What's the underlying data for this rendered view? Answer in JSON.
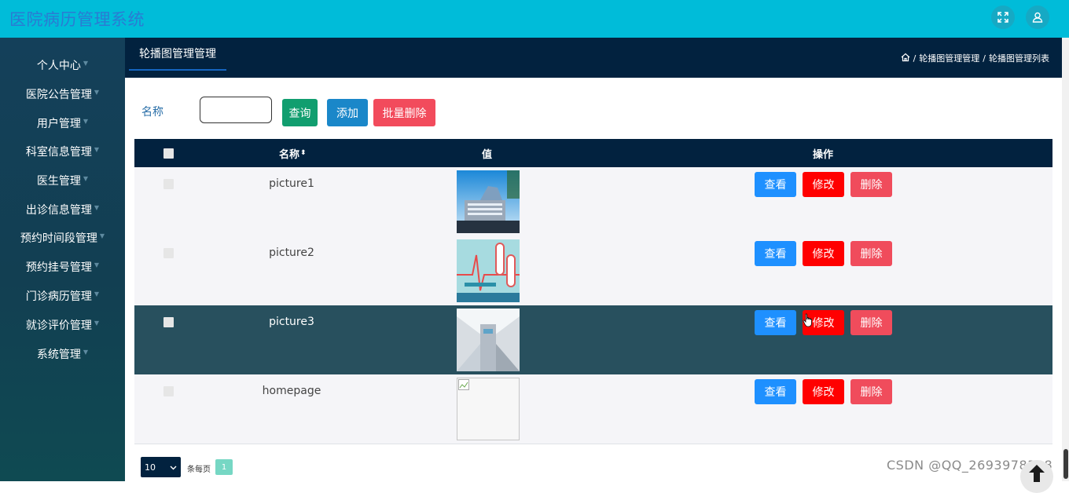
{
  "header": {
    "title": "医院病历管理系统",
    "icons": [
      "fullscreen-icon",
      "user-icon"
    ]
  },
  "sidebar": {
    "items": [
      {
        "label": "个人中心"
      },
      {
        "label": "医院公告管理"
      },
      {
        "label": "用户管理"
      },
      {
        "label": "科室信息管理"
      },
      {
        "label": "医生管理"
      },
      {
        "label": "出诊信息管理"
      },
      {
        "label": "预约时间段管理"
      },
      {
        "label": "预约挂号管理"
      },
      {
        "label": "门诊病历管理"
      },
      {
        "label": "就诊评价管理"
      },
      {
        "label": "系统管理"
      }
    ]
  },
  "subbar": {
    "tab_label": "轮播图管理管理",
    "breadcrumb": {
      "home_icon": "home-icon",
      "sep": "/",
      "level1": "轮播图管理管理",
      "level2": "轮播图管理列表"
    }
  },
  "search": {
    "label": "名称",
    "value": "",
    "query_button": "查询",
    "add_button": "添加",
    "batch_delete_button": "批量删除"
  },
  "table": {
    "headers": {
      "name": "名称",
      "value": "值",
      "actions": "操作"
    },
    "rows": [
      {
        "name": "picture1",
        "view": "查看",
        "edit": "修改",
        "delete": "删除"
      },
      {
        "name": "picture2",
        "view": "查看",
        "edit": "修改",
        "delete": "删除"
      },
      {
        "name": "picture3",
        "view": "查看",
        "edit": "修改",
        "delete": "删除"
      },
      {
        "name": "homepage",
        "view": "查看",
        "edit": "修改",
        "delete": "删除"
      }
    ]
  },
  "pagination": {
    "page_size": "10",
    "per_page_label": "条每页",
    "current_page": "1"
  },
  "watermark": "CSDN @QQ_2693978338",
  "colors": {
    "header_bg": "#00bcd9",
    "title": "#2a7bd3",
    "dark_navy": "#02223f",
    "highlight_row": "#28505e",
    "view_btn": "#1e90ff",
    "edit_btn": "#ff0000",
    "delete_btn": "#f04c5c",
    "query_btn": "#119e6f",
    "add_btn": "#1a87c9",
    "batch_delete_btn": "#f24b5c"
  }
}
